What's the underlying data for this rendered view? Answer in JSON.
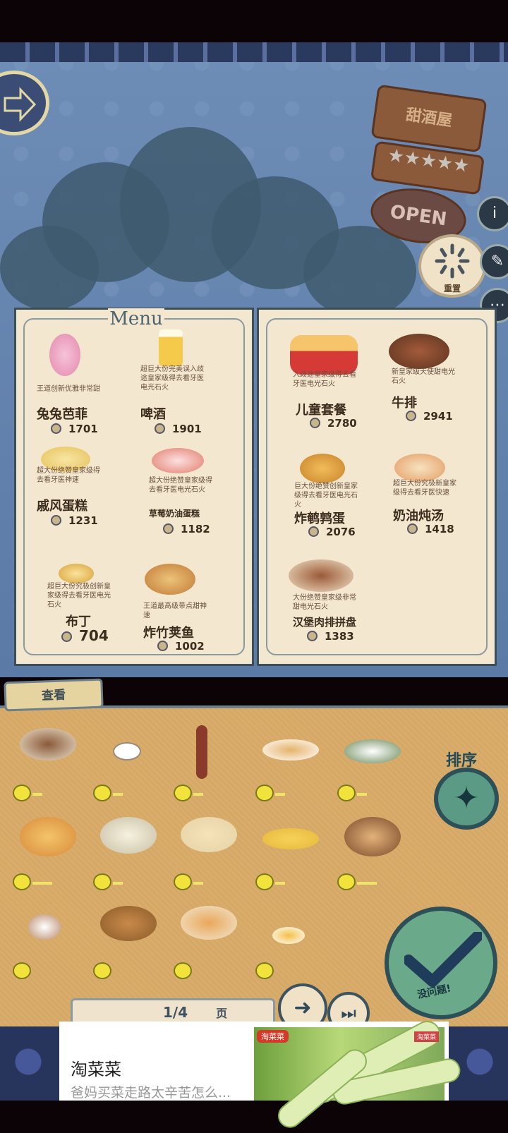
{
  "header": {
    "shop_name": "甜酒屋",
    "open_label": "OPEN",
    "stars": "★★★★★"
  },
  "reset_label": "重置",
  "menu_title": "Menu",
  "left_page": [
    {
      "desc": "王道创新优雅非常甜",
      "name": "兔兔芭菲",
      "price": "1701"
    },
    {
      "desc": "超巨大份完美误入歧途皇家级得去看牙医电光石火",
      "name": "啤酒",
      "price": "1901"
    },
    {
      "desc": "超大份绝赞皇家级得去看牙医神速",
      "name": "戚风蛋糕",
      "price": "1231"
    },
    {
      "desc": "超大份绝赞皇家级得去看牙医电光石火",
      "name": "草莓奶油蛋糕",
      "price": "1182"
    },
    {
      "desc": "超巨大份究极创新皇家级得去看牙医电光石火",
      "name": "布丁",
      "price": "704"
    },
    {
      "desc": "王道最高级带点甜神速",
      "name": "炸竹荚鱼",
      "price": "1002"
    }
  ],
  "right_page": [
    {
      "desc": "入歧途皇家级得去看牙医电光石火",
      "name": "儿童套餐",
      "price": "2780"
    },
    {
      "desc": "新皇家级天使甜电光石火",
      "name": "牛排",
      "price": "2941"
    },
    {
      "desc": "巨大份绝赞创新皇家级得去看牙医电光石火",
      "name": "炸鹌鹑蛋",
      "price": "2076"
    },
    {
      "desc": "超巨大份究极新皇家级得去看牙医快速",
      "name": "奶油炖汤",
      "price": "1418"
    },
    {
      "desc": "大份绝赞皇家级非常甜电光石火",
      "name": "汉堡肉排拼盘",
      "price": "1383"
    }
  ],
  "browse_tab": "查看",
  "sort_label": "排序",
  "sort_icon": "✦",
  "confirm_label": "没问题!",
  "page": {
    "current": "1/4",
    "unit": "页"
  },
  "nav": {
    "next_icon": "➜",
    "last_icon": "⏭"
  },
  "colors": {
    "accent": "#2c4f58",
    "tray": "#d9ac6a",
    "paper": "#f3e7cf"
  },
  "ad": {
    "title": "淘菜菜",
    "desc": "爸妈买菜走路太辛苦怎么...",
    "brand": "淘菜菜",
    "badge": "淘菜菜"
  }
}
